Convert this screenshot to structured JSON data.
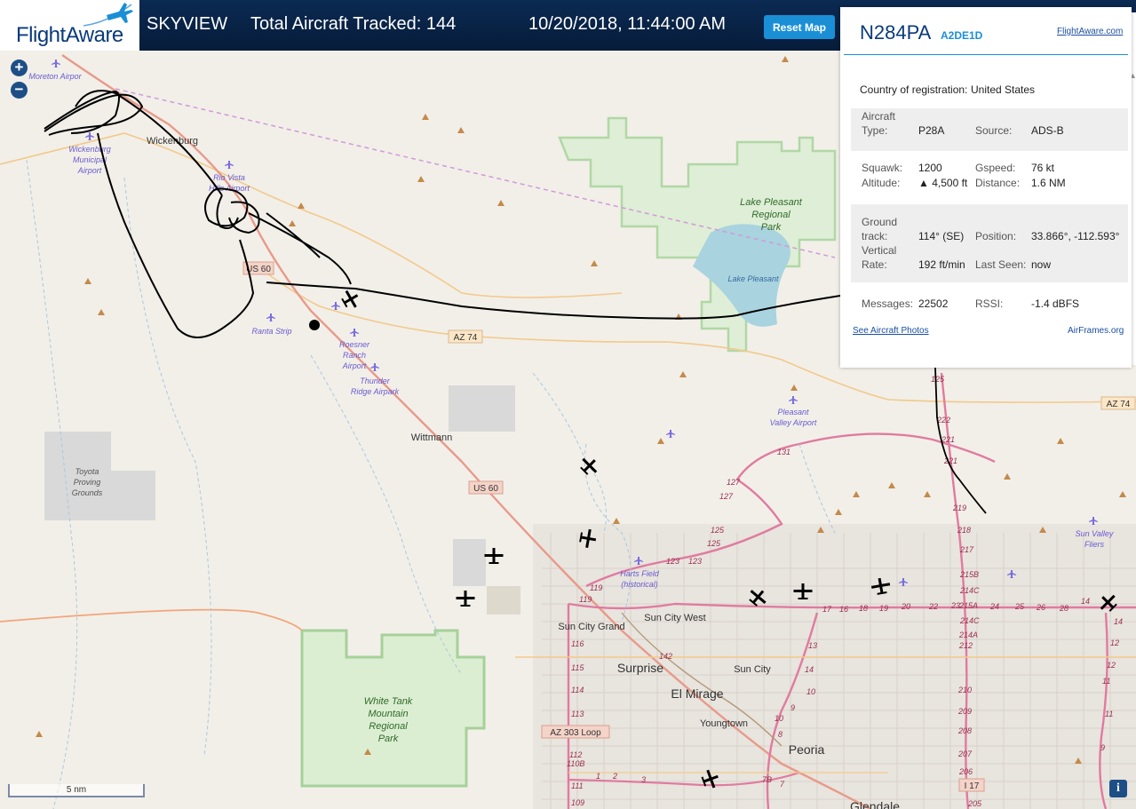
{
  "header": {
    "logo": "FlightAware",
    "app_name": "SKYVIEW",
    "tracked_label": "Total Aircraft Tracked: 144",
    "datetime": "10/20/2018, 11:44:00 AM",
    "reset_label": "Reset Map"
  },
  "panel": {
    "ident": "N284PA",
    "hex": "A2DE1D",
    "fa_link": "FlightAware.com",
    "country_label": "Country of registration:",
    "country_value": "United States",
    "type_label_1": "Aircraft",
    "type_label_2": "Type:",
    "type_value": "P28A",
    "source_label": "Source:",
    "source_value": "ADS-B",
    "squawk_label": "Squawk:",
    "squawk_value": "1200",
    "gspeed_label": "Gspeed:",
    "gspeed_value": "76 kt",
    "altitude_label": "Altitude:",
    "altitude_value": "▲ 4,500 ft",
    "distance_label": "Distance:",
    "distance_value": "1.6 NM",
    "track_label_1": "Ground",
    "track_label_2": "track:",
    "track_value": "114° (SE)",
    "position_label": "Position:",
    "position_value": "33.866°, -112.593°",
    "vrate_label_1": "Vertical",
    "vrate_label_2": "Rate:",
    "vrate_value": "192 ft/min",
    "lastseen_label": "Last Seen:",
    "lastseen_value": "now",
    "messages_label": "Messages:",
    "messages_value": "22502",
    "rssi_label": "RSSI:",
    "rssi_value": "-1.4 dBFS",
    "photos_link": "See Aircraft Photos",
    "airframes_link": "AirFrames.org"
  },
  "map": {
    "scale_label": "5 nm",
    "zoom_in": "+",
    "zoom_out": "−",
    "info_icon": "i",
    "airports": [
      "Moreton Airpor",
      "Wickenburg",
      "Municipal",
      "Airport",
      "Rio Vista",
      "Hills Airport",
      "Ranta Strip",
      "Roesner",
      "Ranch",
      "Airport",
      "Thunder",
      "Ridge Airpark",
      "Pleasant",
      "Valley Airport",
      "Harts Field",
      "(historical)",
      "Sun Valley",
      "Fliers"
    ],
    "towns": [
      "Wickenburg",
      "Wittmann",
      "Sun City Grand",
      "Sun City West",
      "Surprise",
      "Sun City",
      "El Mirage",
      "Youngtown",
      "Peoria",
      "Glendale"
    ],
    "parks": [
      "Lake Pleasant",
      "Regional",
      "Park",
      "Lake Pleasant",
      "White Tank",
      "Mountain",
      "Regional",
      "Park",
      "Toyota",
      "Proving",
      "Grounds"
    ],
    "shields": [
      "US 60",
      "US 60",
      "AZ 74",
      "AZ 74",
      "AZ 303 Loop",
      "I 17"
    ],
    "route_numbers": [
      "125",
      "222",
      "221",
      "221",
      "219",
      "218",
      "217",
      "215B",
      "214C",
      "215A",
      "214C",
      "214A",
      "212",
      "210",
      "209",
      "208",
      "207",
      "206",
      "205",
      "131",
      "127",
      "127",
      "125",
      "125",
      "123",
      "123",
      "119",
      "119",
      "116",
      "115",
      "114",
      "113",
      "112",
      "110B",
      "111",
      "109",
      "142",
      "17",
      "16",
      "18",
      "19",
      "20",
      "22",
      "23",
      "24",
      "25",
      "26",
      "28",
      "14",
      "14",
      "13",
      "12",
      "12",
      "11",
      "10",
      "9",
      "8",
      "7",
      "1",
      "2",
      "3",
      "7B",
      "14",
      "11",
      "10",
      "9"
    ]
  },
  "colors": {
    "accent": "#1a8fd6",
    "header_bg": "#0b2a52",
    "track": "#000000"
  }
}
